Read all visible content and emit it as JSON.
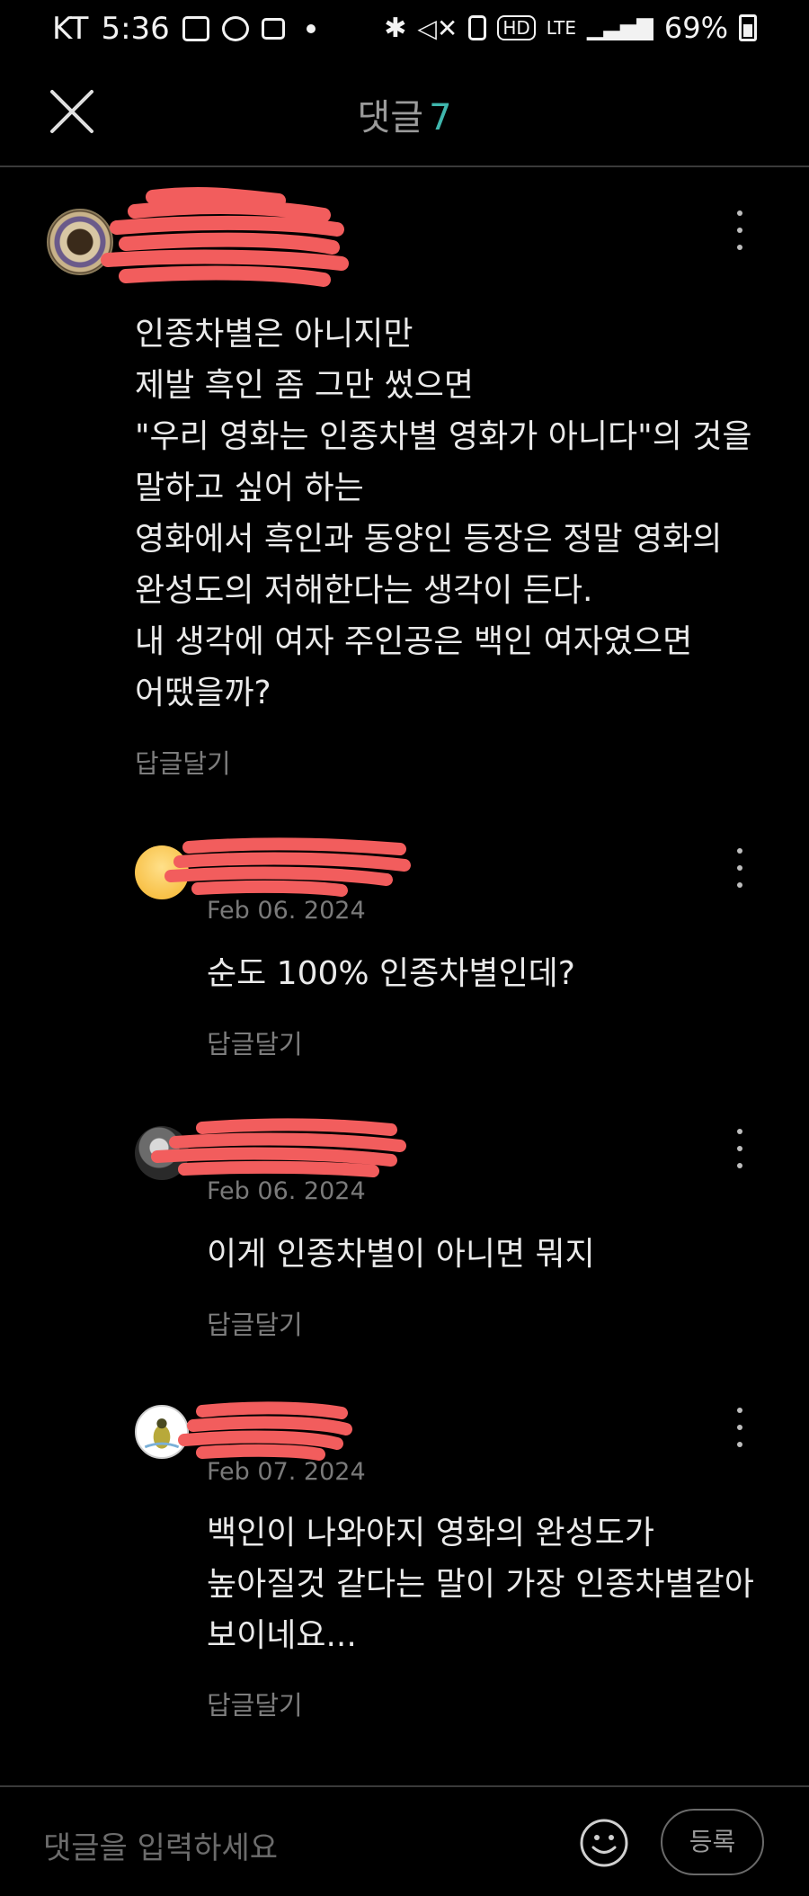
{
  "status_bar": {
    "carrier": "KT",
    "time": "5:36",
    "network": "LTE",
    "battery": "69%",
    "hd_label": "HD"
  },
  "header": {
    "title": "댓글",
    "count": "7"
  },
  "comments": [
    {
      "body": "인종차별은 아니지만\n제발 흑인 좀 그만 썼으면\n\"우리 영화는 인종차별 영화가 아니다\"의 것을\n말하고 싶어 하는\n영화에서 흑인과 동양인 등장은 정말 영화의\n완성도의 저해한다는 생각이 든다.\n내 생각에 여자 주인공은 백인 여자였으면\n어땠을까?",
      "reply_label": "답글달기"
    },
    {
      "date": "Feb 06. 2024",
      "body": "순도 100% 인종차별인데?",
      "reply_label": "답글달기"
    },
    {
      "date": "Feb 06. 2024",
      "body": "이게 인종차별이 아니면 뭐지",
      "reply_label": "답글달기"
    },
    {
      "date": "Feb 07. 2024",
      "body": "백인이 나와야지 영화의 완성도가\n높아질것 같다는 말이 가장 인종차별같아\n보이네요...",
      "reply_label": "답글달기"
    }
  ],
  "input": {
    "placeholder": "댓글을 입력하세요",
    "submit_label": "등록"
  },
  "colors": {
    "accent_count": "#3fb6ad",
    "redaction": "#f25d5d"
  }
}
